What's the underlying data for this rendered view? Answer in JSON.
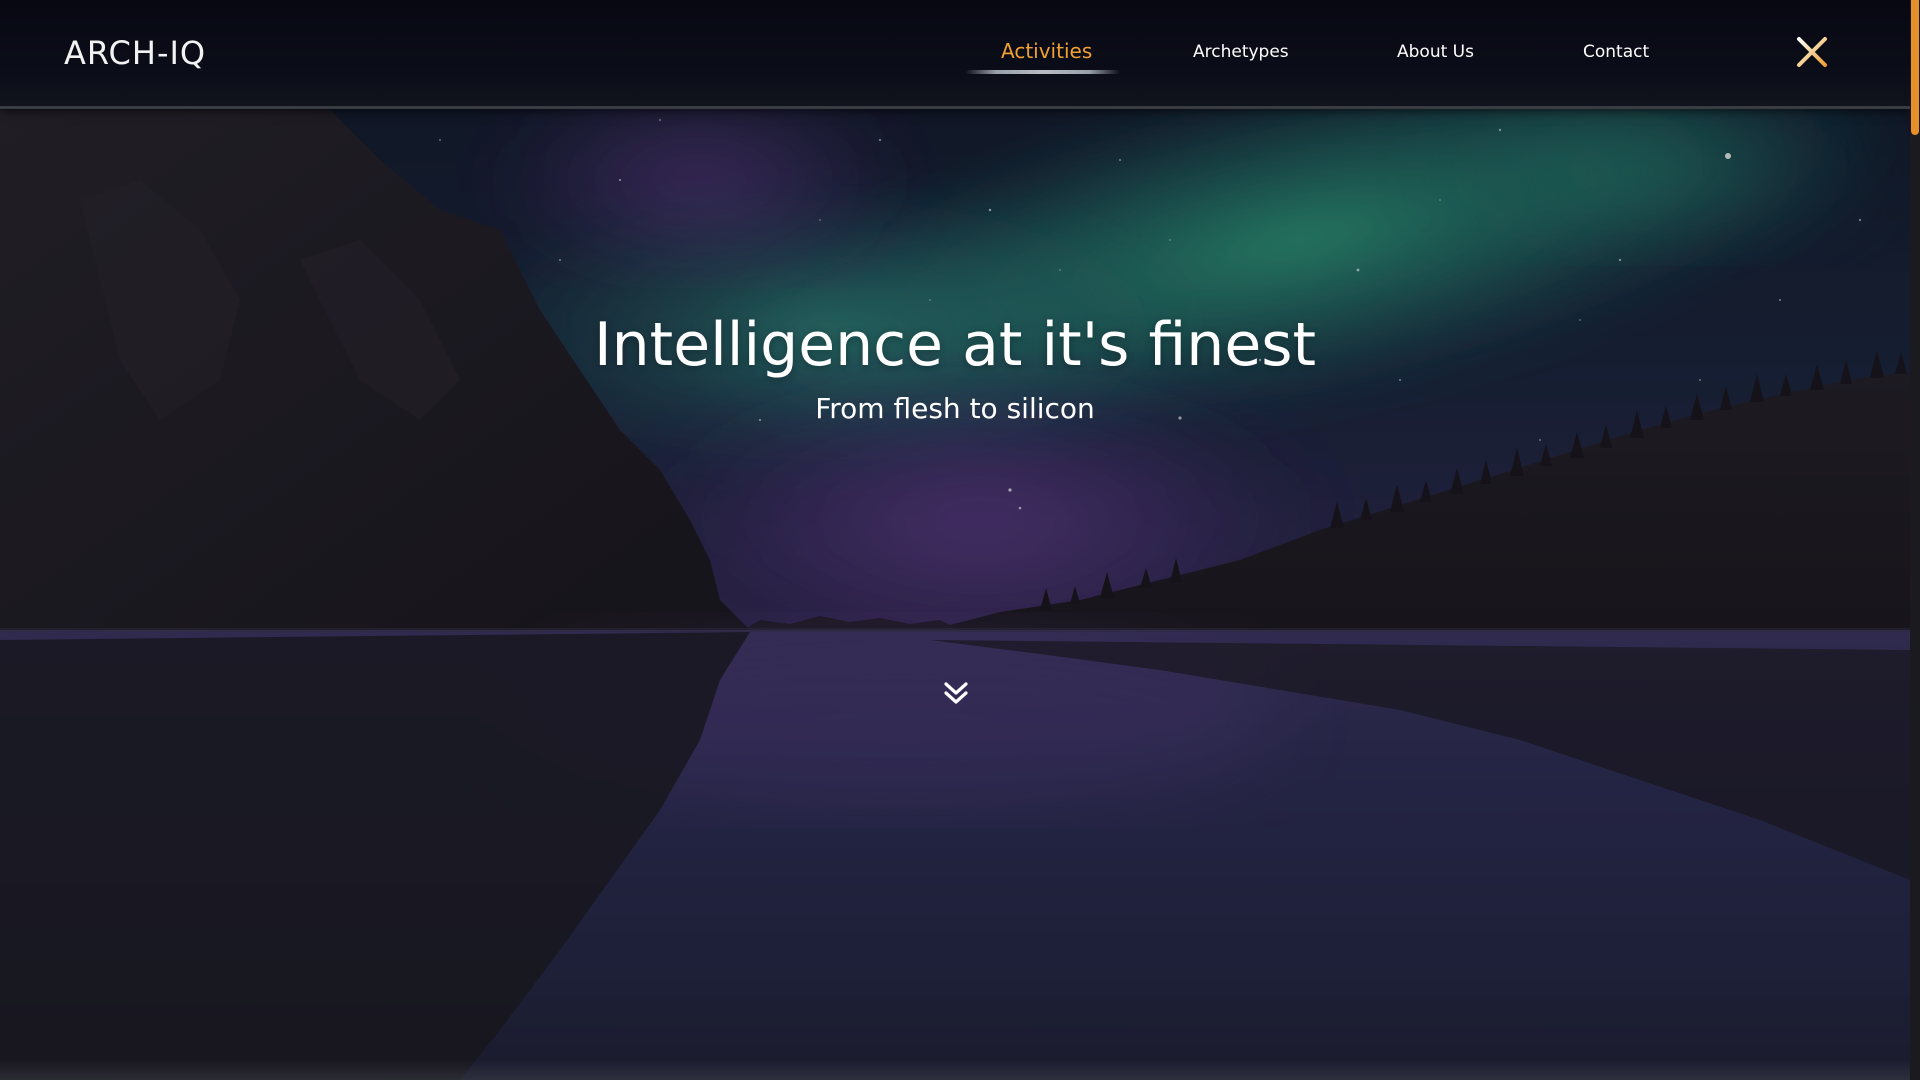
{
  "header": {
    "logo": "ARCH-IQ",
    "nav": [
      {
        "label": "Activities",
        "active": true
      },
      {
        "label": "Archetypes",
        "active": false
      },
      {
        "label": "About Us",
        "active": false
      },
      {
        "label": "Contact",
        "active": false
      }
    ],
    "close_icon": "close-icon"
  },
  "hero": {
    "title": "Intelligence at it's finest",
    "subtitle": "From flesh to silicon",
    "scroll_icon": "double-chevron-down-icon"
  },
  "colors": {
    "accent": "#f1a032",
    "scrollbar_thumb": "#e6902c",
    "header_bg": "#090b15",
    "text": "#ffffff",
    "aurora_green": "#2fae86",
    "aurora_purple": "#6a3e9e"
  },
  "scroll": {
    "position_fraction": 0.0
  }
}
